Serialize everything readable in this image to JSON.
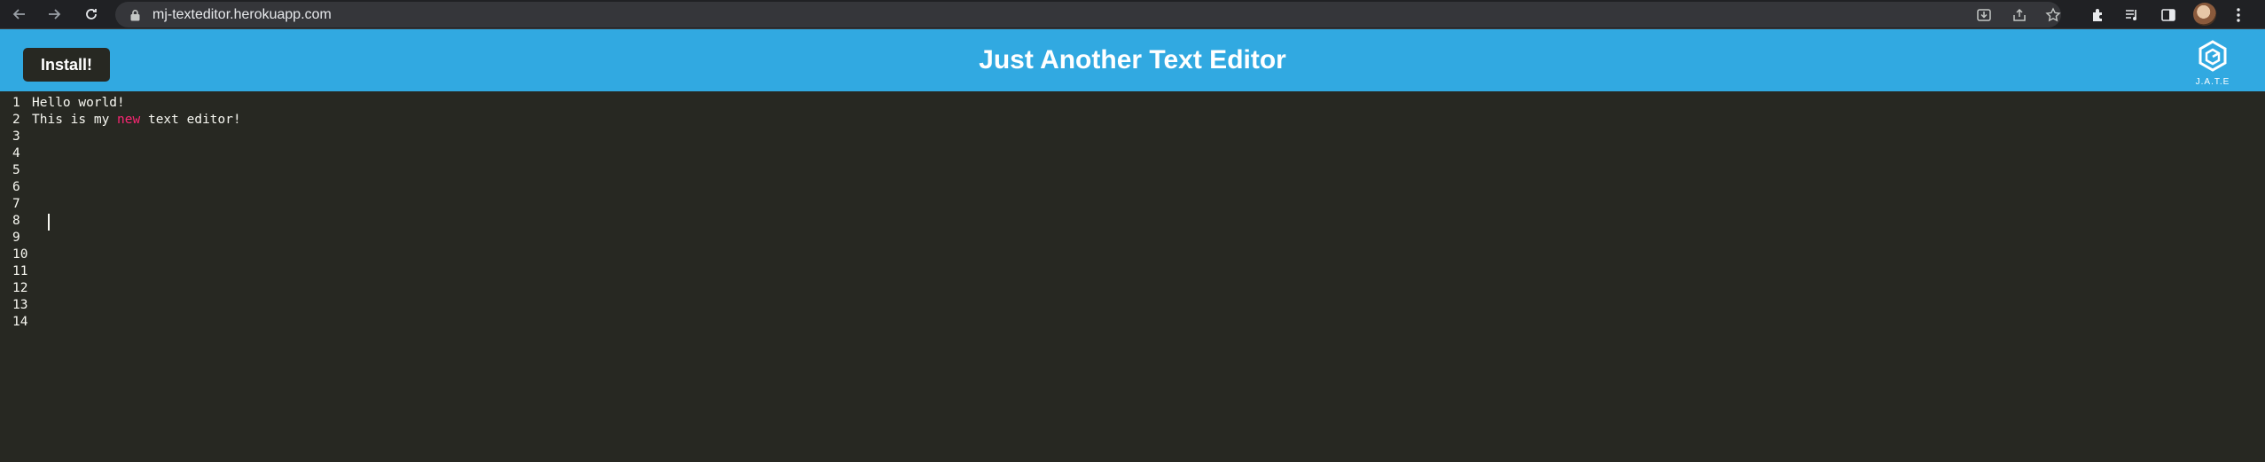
{
  "browser": {
    "url": "mj-texteditor.herokuapp.com",
    "back_icon": "back-arrow-icon",
    "forward_icon": "forward-arrow-icon",
    "reload_icon": "reload-icon"
  },
  "header": {
    "install_label": "Install!",
    "title": "Just Another Text Editor",
    "logo_text": "J.A.T.E",
    "bg_color": "#31a9e1"
  },
  "editor": {
    "line_numbers": [
      "1",
      "2",
      "3",
      "4",
      "5",
      "6",
      "7",
      "8",
      "9",
      "10",
      "11",
      "12",
      "13",
      "14"
    ],
    "lines": [
      [
        {
          "t": "Hello world!"
        }
      ],
      [
        {
          "t": "This is my "
        },
        {
          "t": "new",
          "kw": true
        },
        {
          "t": " text editor!"
        }
      ],
      [],
      [],
      [],
      [],
      [],
      [],
      [],
      [],
      [],
      [],
      [],
      []
    ],
    "cursor_line": 8,
    "bg_color": "#272822",
    "keyword_color": "#f92672"
  }
}
